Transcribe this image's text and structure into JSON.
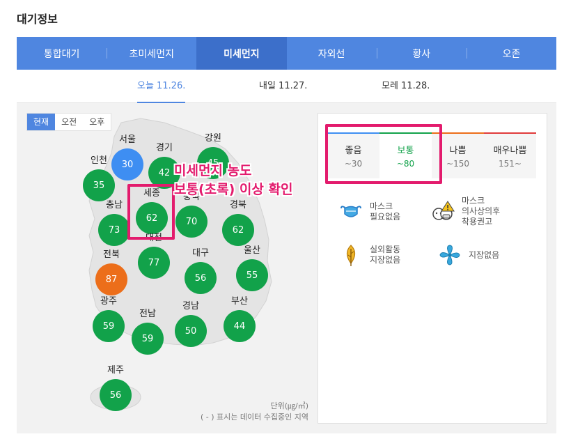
{
  "page": {
    "title": "대기정보"
  },
  "tabs": [
    {
      "label": "통합대기",
      "active": false
    },
    {
      "label": "초미세먼지",
      "active": false
    },
    {
      "label": "미세먼지",
      "active": true
    },
    {
      "label": "자외선",
      "active": false
    },
    {
      "label": "황사",
      "active": false
    },
    {
      "label": "오존",
      "active": false
    }
  ],
  "dates": [
    {
      "label": "오늘 11.26.",
      "active": true
    },
    {
      "label": "내일 11.27.",
      "active": false
    },
    {
      "label": "모레 11.28.",
      "active": false
    }
  ],
  "time_toggle": [
    {
      "label": "현재",
      "active": true
    },
    {
      "label": "오전",
      "active": false
    },
    {
      "label": "오후",
      "active": false
    }
  ],
  "colors": {
    "good": "#3e8ef2",
    "normal": "#12a24a",
    "bad": "#ec6e1a",
    "very_bad": "#e03b3b",
    "highlight": "#e31b6d",
    "tab_bg": "#4f86e0"
  },
  "regions": [
    {
      "name": "서울",
      "value": "30",
      "level": "good"
    },
    {
      "name": "경기",
      "value": "42",
      "level": "normal"
    },
    {
      "name": "강원",
      "value": "45",
      "level": "normal"
    },
    {
      "name": "인천",
      "value": "35",
      "level": "normal"
    },
    {
      "name": "세종",
      "value": "62",
      "level": "normal"
    },
    {
      "name": "충북",
      "value": "70",
      "level": "normal"
    },
    {
      "name": "충남",
      "value": "73",
      "level": "normal"
    },
    {
      "name": "경북",
      "value": "62",
      "level": "normal"
    },
    {
      "name": "대전",
      "value": "77",
      "level": "normal"
    },
    {
      "name": "전북",
      "value": "87",
      "level": "bad"
    },
    {
      "name": "대구",
      "value": "56",
      "level": "normal"
    },
    {
      "name": "울산",
      "value": "55",
      "level": "normal"
    },
    {
      "name": "광주",
      "value": "59",
      "level": "normal"
    },
    {
      "name": "전남",
      "value": "59",
      "level": "normal"
    },
    {
      "name": "경남",
      "value": "50",
      "level": "normal"
    },
    {
      "name": "부산",
      "value": "44",
      "level": "normal"
    },
    {
      "name": "제주",
      "value": "56",
      "level": "normal"
    }
  ],
  "unit_text": "단위(㎍/㎥)",
  "note_text": "( - ) 표시는 데이터 수집중인 지역",
  "legend": {
    "levels": [
      {
        "label": "좋음",
        "range": "~30",
        "color": "#3e8ef2",
        "selected": false
      },
      {
        "label": "보통",
        "range": "~80",
        "color": "#12a24a",
        "selected": true
      },
      {
        "label": "나쁨",
        "range": "~150",
        "color": "#ec6e1a",
        "selected": false
      },
      {
        "label": "매우나쁨",
        "range": "151~",
        "color": "#e03b3b",
        "selected": false
      }
    ],
    "advice": [
      {
        "icon": "mask-icon",
        "line1": "마스크",
        "line2": "필요없음",
        "line3": ""
      },
      {
        "icon": "doctor-warning-icon",
        "line1": "마스크",
        "line2": "의사상의후",
        "line3": "착용권고"
      },
      {
        "icon": "leaf-icon",
        "line1": "실외활동",
        "line2": "지장없음",
        "line3": ""
      },
      {
        "icon": "fan-icon",
        "line1": "지장없음",
        "line2": "",
        "line3": ""
      }
    ]
  },
  "annotation": {
    "line1": "미세먼지 농도",
    "line2": "보통(초록) 이상 확인"
  }
}
